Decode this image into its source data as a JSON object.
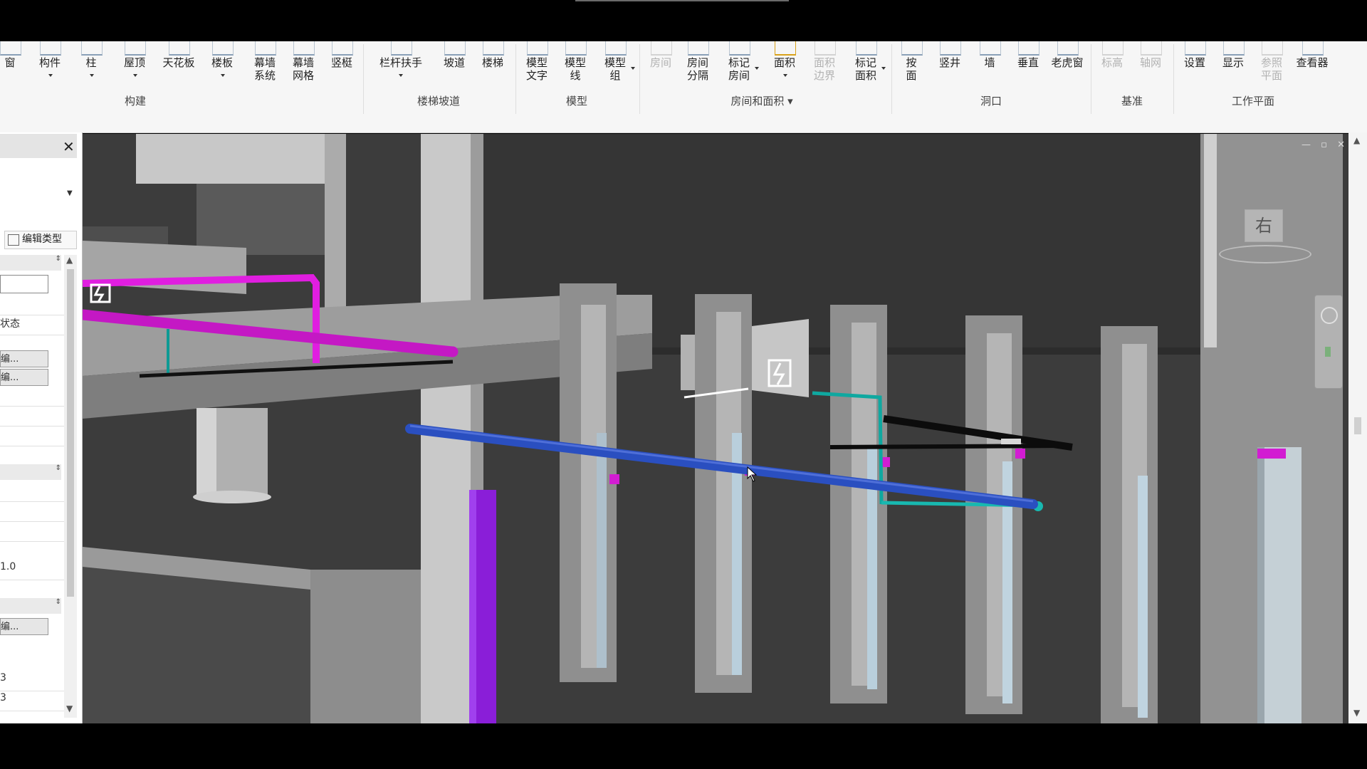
{
  "ribbon": {
    "buttons": [
      {
        "id": "window",
        "label": "窗"
      },
      {
        "id": "component",
        "label": "构件"
      },
      {
        "id": "column",
        "label": "柱"
      },
      {
        "id": "roof",
        "label": "屋顶"
      },
      {
        "id": "ceiling",
        "label": "天花板"
      },
      {
        "id": "floor",
        "label": "楼板"
      },
      {
        "id": "curtain-system",
        "label": "幕墙\n系统"
      },
      {
        "id": "curtain-grid",
        "label": "幕墙\n网格"
      },
      {
        "id": "mullion",
        "label": "竖梃"
      },
      {
        "id": "railing",
        "label": "栏杆扶手"
      },
      {
        "id": "ramp",
        "label": "坡道"
      },
      {
        "id": "stair",
        "label": "楼梯"
      },
      {
        "id": "model-text",
        "label": "模型\n文字"
      },
      {
        "id": "model-line",
        "label": "模型\n线"
      },
      {
        "id": "model-group",
        "label": "模型\n组"
      },
      {
        "id": "room",
        "label": "房间"
      },
      {
        "id": "room-separator",
        "label": "房间\n分隔"
      },
      {
        "id": "tag-room",
        "label": "标记\n房间"
      },
      {
        "id": "area",
        "label": "面积"
      },
      {
        "id": "area-boundary",
        "label": "面积\n边界"
      },
      {
        "id": "tag-area",
        "label": "标记\n面积"
      },
      {
        "id": "by-face",
        "label": "按\n面"
      },
      {
        "id": "shaft",
        "label": "竖井"
      },
      {
        "id": "wall-opening",
        "label": "墙"
      },
      {
        "id": "vertical",
        "label": "垂直"
      },
      {
        "id": "dormer",
        "label": "老虎窗"
      },
      {
        "id": "level",
        "label": "标高"
      },
      {
        "id": "grid",
        "label": "轴网"
      },
      {
        "id": "set",
        "label": "设置"
      },
      {
        "id": "show",
        "label": "显示"
      },
      {
        "id": "ref-plane",
        "label": "参照\n平面"
      },
      {
        "id": "viewer",
        "label": "查看器"
      }
    ],
    "groups": [
      {
        "id": "build",
        "label": "构建"
      },
      {
        "id": "circulation",
        "label": "楼梯坡道"
      },
      {
        "id": "model",
        "label": "模型"
      },
      {
        "id": "room-area",
        "label": "房间和面积 ▾"
      },
      {
        "id": "opening",
        "label": "洞口"
      },
      {
        "id": "datum",
        "label": "基准"
      },
      {
        "id": "work-plane",
        "label": "工作平面"
      }
    ]
  },
  "properties": {
    "close_glyph": "✕",
    "edit_type_label": "编辑类型",
    "row_status": "状态",
    "btn1": "编...",
    "btn2": "编...",
    "btn3": "编...",
    "value_small": "1.0",
    "row_a": "3",
    "row_b": "3"
  },
  "viewport": {
    "viewcube_face": "右",
    "background_color": "#3e3e3e"
  },
  "colors": {
    "magenta_pipe": "#e01ee0",
    "blue_pipe": "#2a4fc0",
    "teal_pipe": "#0fa8a0",
    "purple_pipe": "#8a1ed8",
    "black_pipe": "#111111"
  }
}
